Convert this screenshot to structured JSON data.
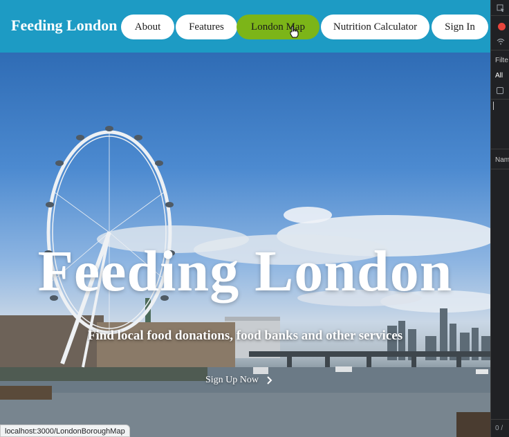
{
  "nav": {
    "brand": "Feeding London",
    "items": [
      {
        "label": "About"
      },
      {
        "label": "Features"
      },
      {
        "label": "London Map",
        "active": true
      },
      {
        "label": "Nutrition Calculator"
      },
      {
        "label": "Sign In"
      }
    ]
  },
  "hero": {
    "title": "Feeding London",
    "subtitle": "Find local food donations, food banks and other services",
    "cta": "Sign Up Now",
    "cta_icon": "chevron-right-icon"
  },
  "status_bar": {
    "url": "localhost:3000/LondonBoroughMap"
  },
  "devtools": {
    "filter_label": "Filte",
    "all_label": "All",
    "name_label": "Nam",
    "footer": "0 /"
  },
  "colors": {
    "navbar": "#1d9bc4",
    "active_nav": "#7cb518",
    "nav_button": "#ffffff"
  }
}
